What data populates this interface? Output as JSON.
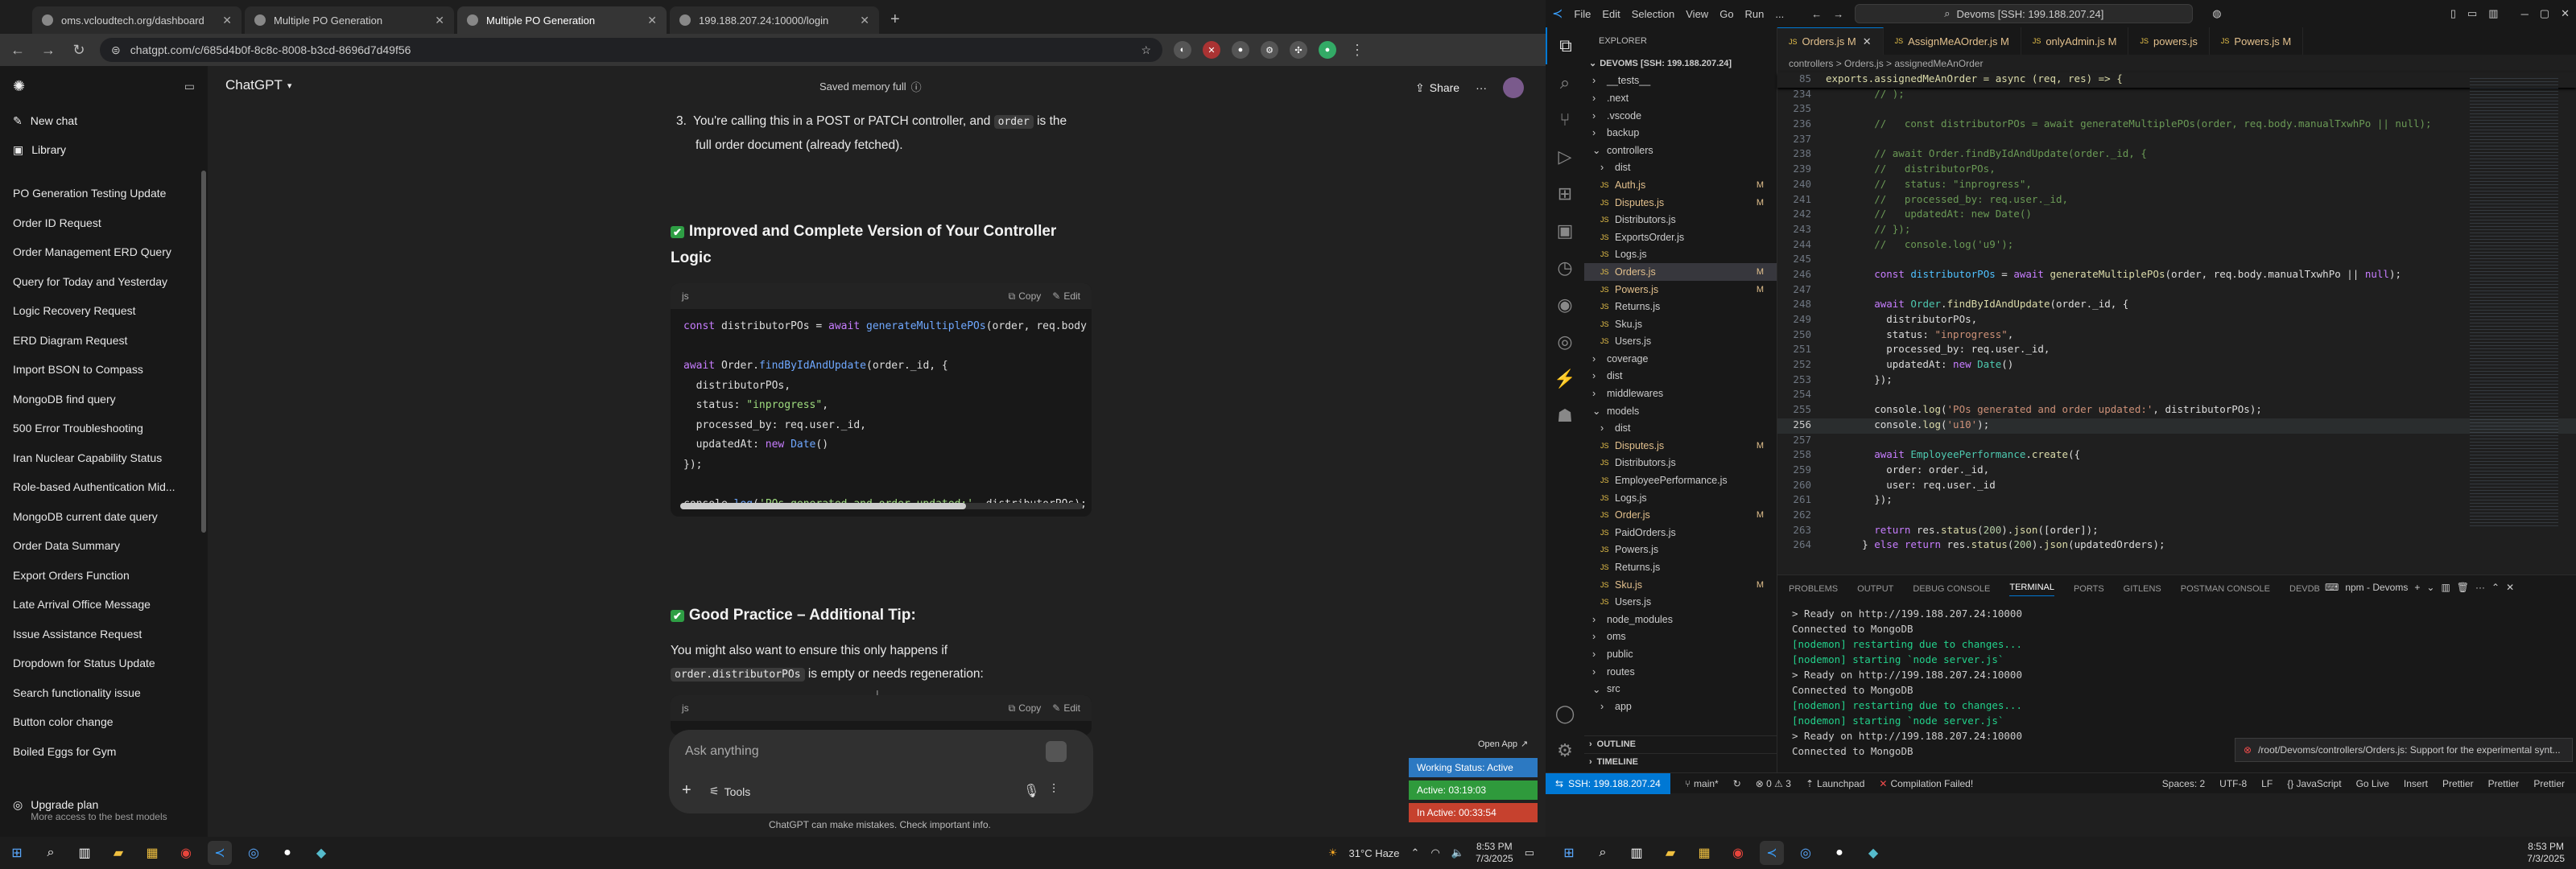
{
  "chrome": {
    "tabs": [
      {
        "title": "oms.vcloudtech.org/dashboard"
      },
      {
        "title": "Multiple PO Generation"
      },
      {
        "title": "Multiple PO Generation"
      },
      {
        "title": "199.188.207.24:10000/login"
      }
    ],
    "url": "chatgpt.com/c/685d4b0f-8c8c-8008-b3cd-8696d7d49f56"
  },
  "gpt": {
    "new_chat": "New chat",
    "library": "Library",
    "history": [
      "PO Generation Testing Update",
      "Order ID Request",
      "Order Management ERD Query",
      "Query for Today and Yesterday",
      "Logic Recovery Request",
      "ERD Diagram Request",
      "Import BSON to Compass",
      "MongoDB find query",
      "500 Error Troubleshooting",
      "Iran Nuclear Capability Status",
      "Role-based Authentication Mid...",
      "MongoDB current date query",
      "Order Data Summary",
      "Export Orders Function",
      "Late Arrival Office Message",
      "Issue Assistance Request",
      "Dropdown for Status Update",
      "Search functionality issue",
      "Button color change",
      "Boiled Eggs for Gym"
    ],
    "upgrade_title": "Upgrade plan",
    "upgrade_sub": "More access to the best models",
    "model": "ChatGPT",
    "memory": "Saved memory full",
    "share": "Share",
    "point3_num": "3.",
    "point3_a": "You're calling this in a POST or PATCH controller, and ",
    "point3_code": "order",
    "point3_b": " is the",
    "point3_line2": "full order document (already fetched).",
    "h_improved": "Improved and Complete Version of Your Controller",
    "h_improved2": "Logic",
    "lang": "js",
    "copy": "Copy",
    "edit": "Edit",
    "h_tip": "Good Practice – Additional Tip:",
    "tip_line1": "You might also want to ensure this only happens if",
    "tip_code": "order.distributorPOs",
    "tip_line2": " is empty or needs regeneration:",
    "ask": "Ask anything",
    "tools": "Tools",
    "disclaimer": "ChatGPT can make mistakes. Check important info.",
    "open_app": "Open App",
    "working_status": "Working Status: Active",
    "active_time": "Active: 03:19:03",
    "inactive_time": "In Active: 00:33:54"
  },
  "vscode": {
    "menu": [
      "File",
      "Edit",
      "Selection",
      "View",
      "Go",
      "Run",
      "..."
    ],
    "search": "Devoms [SSH: 199.188.207.24]",
    "explorer_title": "EXPLORER",
    "workspace": "DEVOMS [SSH: 199.188.207.24]",
    "tree": [
      {
        "n": "__tests__",
        "d": 1,
        "f": 1
      },
      {
        "n": ".next",
        "d": 1,
        "f": 1
      },
      {
        "n": ".vscode",
        "d": 1,
        "f": 1
      },
      {
        "n": "backup",
        "d": 1,
        "f": 1
      },
      {
        "n": "controllers",
        "d": 1,
        "f": 1,
        "o": 1
      },
      {
        "n": "dist",
        "d": 2,
        "f": 1
      },
      {
        "n": "Auth.js",
        "d": 2,
        "s": "M"
      },
      {
        "n": "Disputes.js",
        "d": 2,
        "s": "M"
      },
      {
        "n": "Distributors.js",
        "d": 2
      },
      {
        "n": "ExportsOrder.js",
        "d": 2
      },
      {
        "n": "Logs.js",
        "d": 2
      },
      {
        "n": "Orders.js",
        "d": 2,
        "s": "M",
        "sel": 1
      },
      {
        "n": "Powers.js",
        "d": 2,
        "s": "M"
      },
      {
        "n": "Returns.js",
        "d": 2
      },
      {
        "n": "Sku.js",
        "d": 2
      },
      {
        "n": "Users.js",
        "d": 2
      },
      {
        "n": "coverage",
        "d": 1,
        "f": 1
      },
      {
        "n": "dist",
        "d": 1,
        "f": 1
      },
      {
        "n": "middlewares",
        "d": 1,
        "f": 1
      },
      {
        "n": "models",
        "d": 1,
        "f": 1,
        "o": 1
      },
      {
        "n": "dist",
        "d": 2,
        "f": 1
      },
      {
        "n": "Disputes.js",
        "d": 2,
        "s": "M"
      },
      {
        "n": "Distributors.js",
        "d": 2
      },
      {
        "n": "EmployeePerformance.js",
        "d": 2
      },
      {
        "n": "Logs.js",
        "d": 2
      },
      {
        "n": "Order.js",
        "d": 2,
        "s": "M"
      },
      {
        "n": "PaidOrders.js",
        "d": 2
      },
      {
        "n": "Powers.js",
        "d": 2
      },
      {
        "n": "Returns.js",
        "d": 2
      },
      {
        "n": "Sku.js",
        "d": 2,
        "s": "M"
      },
      {
        "n": "Users.js",
        "d": 2
      },
      {
        "n": "node_modules",
        "d": 1,
        "f": 1
      },
      {
        "n": "oms",
        "d": 1,
        "f": 1
      },
      {
        "n": "public",
        "d": 1,
        "f": 1
      },
      {
        "n": "routes",
        "d": 1,
        "f": 1
      },
      {
        "n": "src",
        "d": 1,
        "f": 1,
        "o": 1
      },
      {
        "n": "app",
        "d": 2,
        "f": 1
      }
    ],
    "outline": "OUTLINE",
    "timeline": "TIMELINE",
    "tabs": [
      "Orders.js M",
      "AssignMeAOrder.js M",
      "onlyAdmin.js M",
      "powers.js",
      "Powers.js M"
    ],
    "breadcrumb": "controllers  >  Orders.js  >  assignedMeAnOrder",
    "sticky": "exports.assignedMeAnOrder = async (req, res) => {",
    "panel_tabs": [
      "PROBLEMS",
      "OUTPUT",
      "DEBUG CONSOLE",
      "TERMINAL",
      "PORTS",
      "GITLENS",
      "POSTMAN CONSOLE",
      "DEVDB"
    ],
    "terminal_label": "npm - Devoms",
    "terminal": [
      "> Ready on http://199.188.207.24:10000",
      "Connected to MongoDB",
      "[nodemon] restarting due to changes...",
      "[nodemon] starting `node server.js`",
      "> Ready on http://199.188.207.24:10000",
      "Connected to MongoDB",
      "[nodemon] restarting due to changes...",
      "[nodemon] starting `node server.js`",
      "> Ready on http://199.188.207.24:10000",
      "Connected to MongoDB"
    ],
    "notification": "/root/Devoms/controllers/Orders.js: Support for the experimental synt...",
    "status_remote": "SSH: 199.188.207.24",
    "status_branch": "main*",
    "status_errors": "⊗ 0 ⚠ 3",
    "status_launch": "Launchpad",
    "status_compile": "Compilation Failed!",
    "status_right": [
      "Spaces: 2",
      "UTF-8",
      "LF",
      "{} JavaScript",
      "Go Live",
      "Insert",
      "Prettier",
      "Prettier",
      "Prettier"
    ]
  },
  "taskbar": {
    "weather": "31°C  Haze",
    "time1": "8:53 PM",
    "date1": "7/3/2025",
    "time2": "8:53 PM",
    "date2": "7/3/2025"
  }
}
